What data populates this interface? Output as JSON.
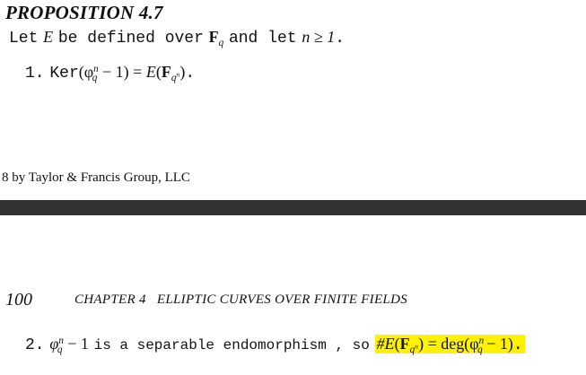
{
  "top_page": {
    "title": "PROPOSITION 4.7",
    "intro": {
      "let": "Let",
      "E": "E",
      "be_defined_over": "be defined over",
      "F": "F",
      "q": "q",
      "and_let": "and let",
      "n_ge_1": "n ≥ 1",
      "period": "."
    },
    "item1": {
      "number": "1.",
      "ker": "Ker",
      "lhs": "(φ",
      "sup_n": "n",
      "sub_q": "q",
      "minus1": "− 1) = ",
      "E": "E",
      "paren_open": "(",
      "F": "F",
      "sub_qn": "q",
      "sub_qn_sup": "n",
      "paren_close": ")",
      "period": "."
    },
    "copyright": "8 by Taylor & Francis Group, LLC"
  },
  "bottom_page": {
    "page_number": "100",
    "running_header": "CHAPTER 4   ELLIPTIC CURVES OVER FINITE FIELDS",
    "item2": {
      "number": "2.",
      "phi": "φ",
      "sup_n": "n",
      "sub_q": "q",
      "minus1": "− 1",
      "text": "is a separable endomorphism , so",
      "hash_E": "#E",
      "paren_open": "(",
      "F": "F",
      "sub_qn": "q",
      "sub_qn_sup": "n",
      "paren_close": ")",
      "eq_deg": " = deg(φ",
      "deg_sup_n": "n",
      "deg_sub_q": "q",
      "deg_tail": " − 1)",
      "period": "."
    }
  },
  "colors": {
    "highlight": "#fff200",
    "divider_bar": "#333333"
  }
}
